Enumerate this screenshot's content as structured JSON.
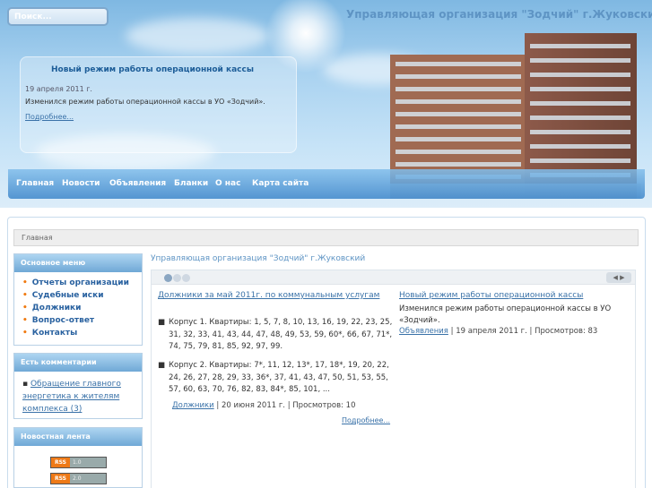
{
  "search": {
    "placeholder": "Поиск..."
  },
  "site_title": "Управляющая организация \"Зодчий\" г.Жуковский",
  "header_news": {
    "title": "Новый режим работы операционной кассы",
    "date": "19 апреля 2011 г.",
    "text": "Изменился режим работы операционной кассы в УО «Зодчий».",
    "more": "Подробнее..."
  },
  "nav": [
    "Главная",
    "Новости",
    "Объявления",
    "Бланки",
    "О нас",
    "Карта сайта"
  ],
  "breadcrumb": "Главная",
  "sidebar": {
    "main_menu_title": "Основное меню",
    "main_menu": [
      "Отчеты организации",
      "Судебные иски",
      "Должники",
      "Вопрос-ответ",
      "Контакты"
    ],
    "comments_title": "Есть комментарии",
    "comment_link": "Обращение главного энергетика к жителям комплекса (3)",
    "feed_title": "Новостная лента",
    "rss": [
      {
        "label": "RSS",
        "version": "1.0"
      },
      {
        "label": "RSS",
        "version": "2.0"
      }
    ]
  },
  "main": {
    "title": "Управляющая организация \"Зодчий\" г.Жуковский",
    "left_article": {
      "title": "Должники за май 2011г. по коммунальным услугам",
      "items": [
        "Корпус 1. Квартиры: 1, 5, 7, 8, 10, 13, 16, 19, 22, 23, 25, 31, 32, 33, 41, 43, 44, 47, 48, 49, 53, 59, 60*, 66, 67, 71*, 74, 75, 79, 81, 85, 92, 97, 99.",
        "Корпус 2. Квартиры: 7*, 11, 12, 13*, 17, 18*, 19, 20, 22, 24, 26, 27, 28, 29, 33, 36*, 37, 41, 43, 47, 50, 51, 53, 55, 57, 60, 63, 70, 76, 82, 83, 84*, 85, 101, ..."
      ],
      "category": "Должники",
      "meta": "| 20 июня 2011 г. | Просмотров: 10",
      "more": "Подробнее..."
    },
    "right_article": {
      "title": "Новый режим работы операционной кассы",
      "text": "Изменился режим работы операционной кассы в УО «Зодчий».",
      "category": "Объявления",
      "meta": "| 19 апреля 2011 г. | Просмотров: 83"
    }
  },
  "colors": {
    "accent": "#3a72a8",
    "title": "#5e94c4",
    "bullet": "#f07a10"
  },
  "icons": [
    "rss-icon",
    "slider-dot-icon",
    "slider-arrows-icon"
  ]
}
